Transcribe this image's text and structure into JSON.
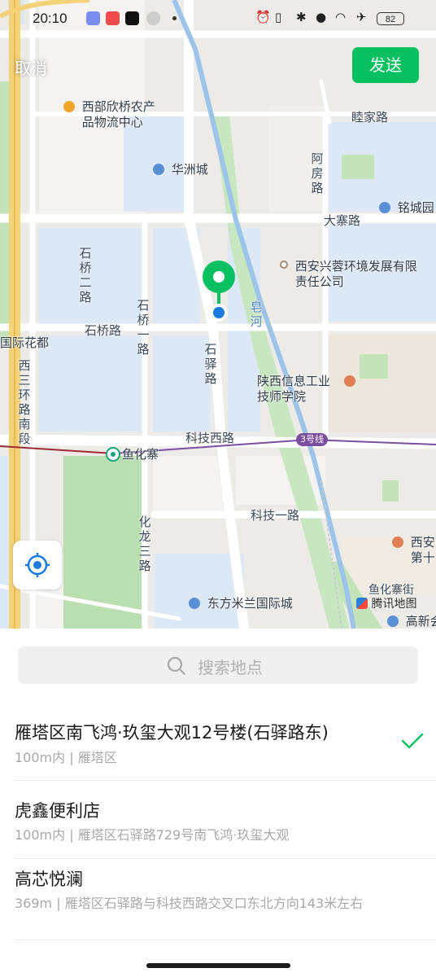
{
  "status_bar": {
    "time": "20:10",
    "battery": "82"
  },
  "header": {
    "cancel_label": "取消",
    "send_label": "发送"
  },
  "map": {
    "roads": {
      "kuijia_road": "睦家路",
      "dazhai_road": "大寨路",
      "afang_road": "阿房路",
      "shiqiao_road": "石桥路",
      "shiqiao_2nd_road": "石桥二路",
      "shiqiao_1st_road": "石桥一路",
      "shiyi_road": "石驿路",
      "zao_river": "皂河",
      "west_3rd_ring_south": "西三环路南段",
      "keji_west_road": "科技西路",
      "keji_1st_road": "科技一路",
      "huilong_3rd_road": "化龙三路",
      "metro_line": "3号线",
      "yuhuazhai_street": "鱼化寨街",
      "gaoxin_partial": "高新会"
    },
    "pois": {
      "west_market": "西部欣桥农产品物流中心",
      "huazhou_city": "华洲城",
      "mingcheng_garden": "铭城园",
      "env_company": "西安兴蓉环境发展有限责任公司",
      "shaanxi_tech_school": "陕西信息工业技师学院",
      "intl_garden": "国际花都",
      "yuhuazhai_station": "鱼化寨",
      "dongfang_milan": "东方米兰国际城",
      "xian_partial": "西安第十"
    },
    "attribution": "腾讯地图"
  },
  "search": {
    "placeholder": "搜索地点"
  },
  "results": [
    {
      "title": "雁塔区南飞鸿·玖玺大观12号楼(石驿路东)",
      "subtitle": "100m内 | 雁塔区",
      "selected": true
    },
    {
      "title": "虎鑫便利店",
      "subtitle": "100m内 | 雁塔区石驿路729号南飞鸿·玖玺大观",
      "selected": false
    },
    {
      "title": "高芯悦澜",
      "subtitle": "369m | 雁塔区石驿路与科技西路交叉口东北方向143米左右",
      "selected": false
    }
  ],
  "colors": {
    "accent_green": "#07c160",
    "map_bg": "#ecebe8",
    "water": "#9cc3e8",
    "park": "#b9dfb0"
  },
  "icons": {
    "search": "search-icon",
    "locate": "locate-icon",
    "check": "check-icon",
    "pin": "map-pin-icon"
  }
}
